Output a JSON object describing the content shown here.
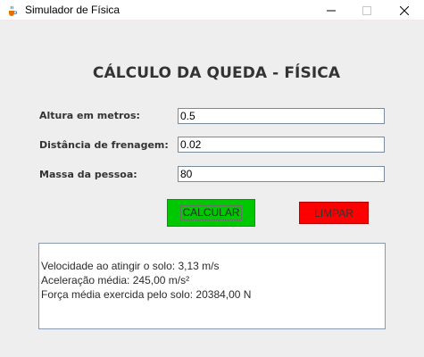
{
  "window": {
    "title": "Simulador de Física"
  },
  "form": {
    "heading": "CÁLCULO DA QUEDA - FÍSICA",
    "height_label": "Altura em metros:",
    "height_value": "0.5",
    "braking_label": "Distância de frenagem:",
    "braking_value": "0.02",
    "mass_label": "Massa da pessoa:",
    "mass_value": "80"
  },
  "buttons": {
    "calculate": "CALCULAR",
    "clear": "LIMPAR"
  },
  "results": {
    "velocity": "Velocidade ao atingir o solo: 3,13 m/s",
    "acceleration": "Aceleração média: 245,00 m/s²",
    "force": "Força média exercida pelo solo: 20384,00 N"
  },
  "colors": {
    "calculate_button": "#00c800",
    "clear_button": "#ff0000"
  },
  "icons": {
    "app": "java-coffee-icon",
    "minimize": "minimize-icon",
    "maximize": "maximize-icon",
    "close": "close-icon"
  }
}
